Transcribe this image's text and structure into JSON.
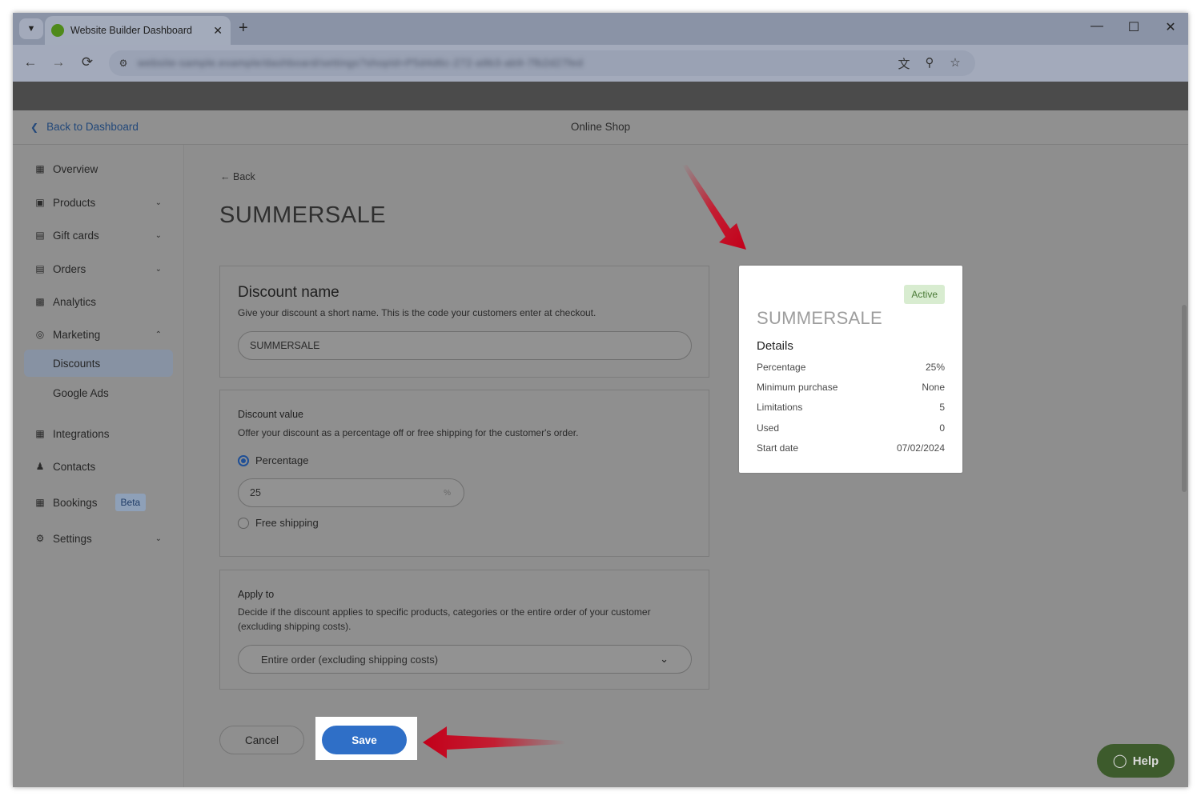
{
  "browser": {
    "tab_title": "Website Builder Dashboard",
    "url": "website-sample.example/dashboard/settings?shopId=P5d4d6c-272-a9b3-ab9-7fb2d27fed"
  },
  "topbar": {
    "back_label": "Back to Dashboard",
    "title": "Online Shop"
  },
  "sidebar": {
    "items": [
      {
        "label": "Overview",
        "icon": "grid-icon"
      },
      {
        "label": "Products",
        "icon": "save-icon"
      },
      {
        "label": "Gift cards",
        "icon": "gift-icon"
      },
      {
        "label": "Orders",
        "icon": "document-icon"
      },
      {
        "label": "Analytics",
        "icon": "bar-chart-icon"
      },
      {
        "label": "Marketing",
        "icon": "target-icon"
      },
      {
        "label": "Discounts"
      },
      {
        "label": "Google Ads"
      },
      {
        "label": "Integrations",
        "icon": "integrations-icon"
      },
      {
        "label": "Contacts",
        "icon": "contacts-icon"
      },
      {
        "label": "Bookings",
        "icon": "calendar-icon",
        "badge": "Beta"
      },
      {
        "label": "Settings",
        "icon": "gear-icon"
      }
    ]
  },
  "main": {
    "back_label": "Back",
    "page_title": "SUMMERSALE",
    "name_card": {
      "title": "Discount name",
      "description": "Give your discount a short name. This is the code your customers enter at checkout.",
      "value": "SUMMERSALE"
    },
    "value_card": {
      "title": "Discount value",
      "description": "Offer your discount as a percentage off or free shipping for the customer's order.",
      "option_percentage": "Percentage",
      "percentage_value": "25",
      "percentage_unit": "%",
      "option_free_shipping": "Free shipping"
    },
    "apply_card": {
      "title": "Apply to",
      "description": "Decide if the discount applies to specific products, categories or the entire order of your customer (excluding shipping costs).",
      "selected": "Entire order (excluding shipping costs)"
    },
    "cancel_label": "Cancel",
    "save_label": "Save"
  },
  "summary": {
    "status": "Active",
    "title": "SUMMERSALE",
    "details_heading": "Details",
    "rows": [
      {
        "label": "Percentage",
        "value": "25%"
      },
      {
        "label": "Minimum purchase",
        "value": "None"
      },
      {
        "label": "Limitations",
        "value": "5"
      },
      {
        "label": "Used",
        "value": "0"
      },
      {
        "label": "Start date",
        "value": "07/02/2024"
      }
    ]
  },
  "help_label": "Help",
  "colors": {
    "accent": "#2f6fc7",
    "annotation_arrow": "#d0021b",
    "status_active_bg": "#d8ecd0",
    "help_bg": "#3d5b2c"
  }
}
